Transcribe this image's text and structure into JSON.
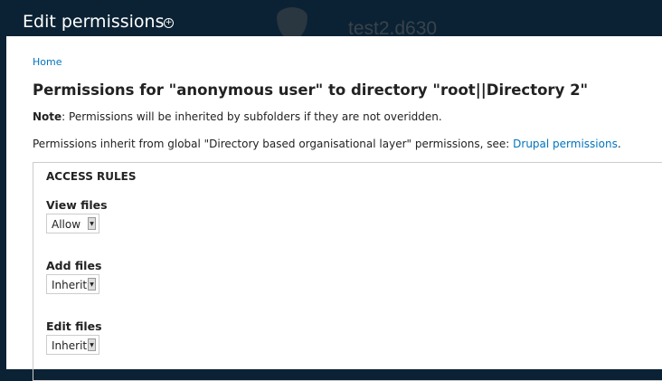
{
  "header": {
    "title": "Edit permissions",
    "site_name": "test2.d630"
  },
  "breadcrumb": "Home",
  "page_title": "Permissions for \"anonymous user\" to directory \"root||Directory 2\"",
  "note_label": "Note",
  "note_text": ": Permissions will be inherited by subfolders if they are not overidden.",
  "inherit_text": "Permissions inherit from global \"Directory based organisational layer\" permissions, see: ",
  "inherit_link": "Drupal permissions",
  "inherit_end": ".",
  "access_rules": {
    "legend": "ACCESS RULES",
    "rules": [
      {
        "label": "View files",
        "value": "Allow"
      },
      {
        "label": "Add files",
        "value": "Inherit"
      },
      {
        "label": "Edit files",
        "value": "Inherit"
      }
    ]
  }
}
